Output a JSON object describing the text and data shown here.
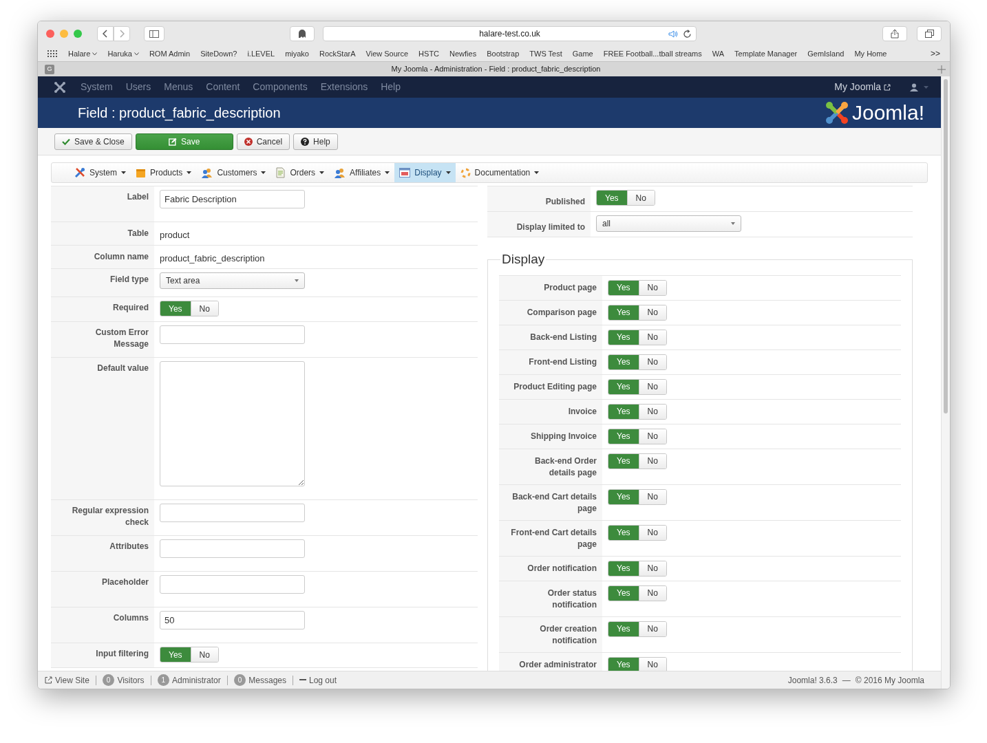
{
  "browser": {
    "url": "halare-test.co.uk",
    "tab_favicon": "G",
    "tab_title": "My Joomla - Administration - Field : product_fabric_description",
    "bookmarks": [
      {
        "label": "Halare",
        "menu": true
      },
      {
        "label": "Haruka",
        "menu": true
      },
      {
        "label": "ROM Admin",
        "menu": false
      },
      {
        "label": "SiteDown?",
        "menu": false
      },
      {
        "label": "i.LEVEL",
        "menu": false
      },
      {
        "label": "miyako",
        "menu": false
      },
      {
        "label": "RockStarA",
        "menu": false
      },
      {
        "label": "View Source",
        "menu": false
      },
      {
        "label": "HSTC",
        "menu": false
      },
      {
        "label": "Newfies",
        "menu": false
      },
      {
        "label": "Bootstrap",
        "menu": false
      },
      {
        "label": "TWS Test",
        "menu": false
      },
      {
        "label": "Game",
        "menu": false
      },
      {
        "label": "FREE Football...tball streams",
        "menu": false
      },
      {
        "label": "WA",
        "menu": false
      },
      {
        "label": "Template Manager",
        "menu": false
      },
      {
        "label": "GemIsland",
        "menu": false
      },
      {
        "label": "My Home",
        "menu": false
      }
    ],
    "overflow": ">>"
  },
  "admin_menu": {
    "items": [
      "System",
      "Users",
      "Menus",
      "Content",
      "Components",
      "Extensions",
      "Help"
    ],
    "site_link": "My Joomla"
  },
  "page_title": "Field : product_fabric_description",
  "logo_text": "Joomla!",
  "toolbar": [
    {
      "kind": "save_close",
      "label": "Save & Close"
    },
    {
      "kind": "save",
      "label": "Save"
    },
    {
      "kind": "cancel",
      "label": "Cancel"
    },
    {
      "kind": "help",
      "label": "Help"
    }
  ],
  "submenu": [
    {
      "label": "System",
      "selected": false
    },
    {
      "label": "Products",
      "selected": false
    },
    {
      "label": "Customers",
      "selected": false
    },
    {
      "label": "Orders",
      "selected": false
    },
    {
      "label": "Affiliates",
      "selected": false
    },
    {
      "label": "Display",
      "selected": true
    },
    {
      "label": "Documentation",
      "selected": false
    }
  ],
  "left_fields": [
    {
      "kind": "text",
      "label": "Label",
      "value": "Fabric Description"
    },
    {
      "kind": "static",
      "label": "Table",
      "value": "product"
    },
    {
      "kind": "static",
      "label": "Column name",
      "value": "product_fabric_description"
    },
    {
      "kind": "select",
      "label": "Field type",
      "value": "Text area"
    },
    {
      "kind": "toggle",
      "label": "Required",
      "options": [
        {
          "label": "Yes",
          "selected": true
        },
        {
          "label": "No",
          "selected": false
        }
      ]
    },
    {
      "kind": "text",
      "label": "Custom Error Message"
    },
    {
      "kind": "textarea",
      "label": "Default value"
    },
    {
      "kind": "text",
      "label": "Regular expression check"
    },
    {
      "kind": "text",
      "label": "Attributes"
    },
    {
      "kind": "text",
      "label": "Placeholder"
    },
    {
      "kind": "text",
      "label": "Columns",
      "value": "50"
    },
    {
      "kind": "toggle",
      "label": "Input filtering",
      "options": [
        {
          "label": "Yes",
          "selected": true
        },
        {
          "label": "No",
          "selected": false
        }
      ]
    }
  ],
  "right_fields": [
    {
      "kind": "toggle",
      "label": "Published",
      "options": [
        {
          "label": "Yes",
          "selected": true
        },
        {
          "label": "No",
          "selected": false
        }
      ]
    },
    {
      "kind": "select",
      "label": "Display limited to",
      "value": "all"
    }
  ],
  "display_fieldset": {
    "legend": "Display",
    "rows": [
      {
        "label": "Product page",
        "options": [
          {
            "label": "Yes",
            "selected": true
          },
          {
            "label": "No",
            "selected": false
          }
        ]
      },
      {
        "label": "Comparison page",
        "options": [
          {
            "label": "Yes",
            "selected": true
          },
          {
            "label": "No",
            "selected": false
          }
        ]
      },
      {
        "label": "Back-end Listing",
        "options": [
          {
            "label": "Yes",
            "selected": true
          },
          {
            "label": "No",
            "selected": false
          }
        ]
      },
      {
        "label": "Front-end Listing",
        "options": [
          {
            "label": "Yes",
            "selected": true
          },
          {
            "label": "No",
            "selected": false
          }
        ]
      },
      {
        "label": "Product Editing page",
        "options": [
          {
            "label": "Yes",
            "selected": true
          },
          {
            "label": "No",
            "selected": false
          }
        ]
      },
      {
        "label": "Invoice",
        "options": [
          {
            "label": "Yes",
            "selected": true
          },
          {
            "label": "No",
            "selected": false
          }
        ]
      },
      {
        "label": "Shipping Invoice",
        "options": [
          {
            "label": "Yes",
            "selected": true
          },
          {
            "label": "No",
            "selected": false
          }
        ]
      },
      {
        "label": "Back-end Order details page",
        "options": [
          {
            "label": "Yes",
            "selected": true
          },
          {
            "label": "No",
            "selected": false
          }
        ]
      },
      {
        "label": "Back-end Cart details page",
        "options": [
          {
            "label": "Yes",
            "selected": true
          },
          {
            "label": "No",
            "selected": false
          }
        ]
      },
      {
        "label": "Front-end Cart details page",
        "options": [
          {
            "label": "Yes",
            "selected": true
          },
          {
            "label": "No",
            "selected": false
          }
        ]
      },
      {
        "label": "Order notification",
        "options": [
          {
            "label": "Yes",
            "selected": true
          },
          {
            "label": "No",
            "selected": false
          }
        ]
      },
      {
        "label": "Order status notification",
        "options": [
          {
            "label": "Yes",
            "selected": true
          },
          {
            "label": "No",
            "selected": false
          }
        ]
      },
      {
        "label": "Order creation notification",
        "options": [
          {
            "label": "Yes",
            "selected": true
          },
          {
            "label": "No",
            "selected": false
          }
        ]
      },
      {
        "label": "Order administrator",
        "options": [
          {
            "label": "Yes",
            "selected": true
          },
          {
            "label": "No",
            "selected": false
          }
        ]
      }
    ]
  },
  "footer": {
    "items": [
      {
        "kind": "link",
        "label": "View Site"
      },
      {
        "kind": "count",
        "count": "0",
        "label": "Visitors"
      },
      {
        "kind": "count",
        "count": "1",
        "label": "Administrator"
      },
      {
        "kind": "count",
        "count": "0",
        "label": "Messages"
      },
      {
        "kind": "logout",
        "label": "Log out"
      }
    ],
    "version": "Joomla! 3.6.3",
    "dash": "—",
    "copyright": "© 2016 My Joomla"
  }
}
